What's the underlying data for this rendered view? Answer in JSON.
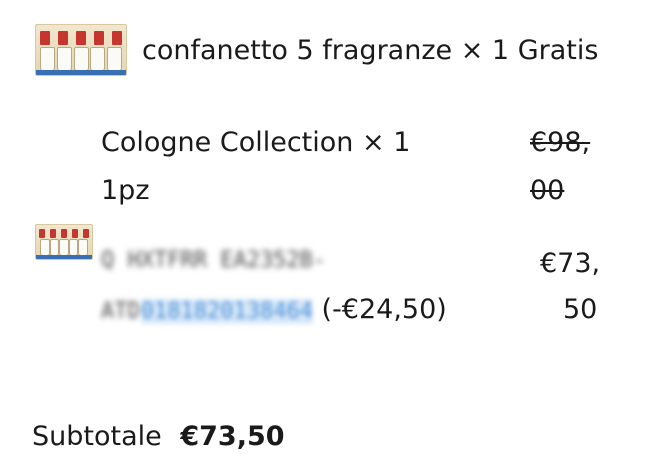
{
  "gift_item": {
    "name": "confanetto 5 fragranze",
    "quantity": "× 1",
    "price": "Gratis",
    "thumbnail_icon": "perfume-gift-box-image"
  },
  "product_item": {
    "name": "Cologne Collection",
    "quantity": "× 1",
    "unit": "1pz",
    "original_price_line1": "€98,",
    "original_price_line2": "00"
  },
  "discount_item": {
    "thumbnail_icon": "perfume-gift-box-image",
    "code_line1": "Q HXTFRR EA2352B-",
    "code_line2_prefix": "ATD",
    "code_line2_link": "0181820138464",
    "amount": "(-€24,50)",
    "final_price_line1": "€73,",
    "final_price_line2": "50"
  },
  "subtotal": {
    "label": "Subtotale",
    "value": "€73,50"
  }
}
